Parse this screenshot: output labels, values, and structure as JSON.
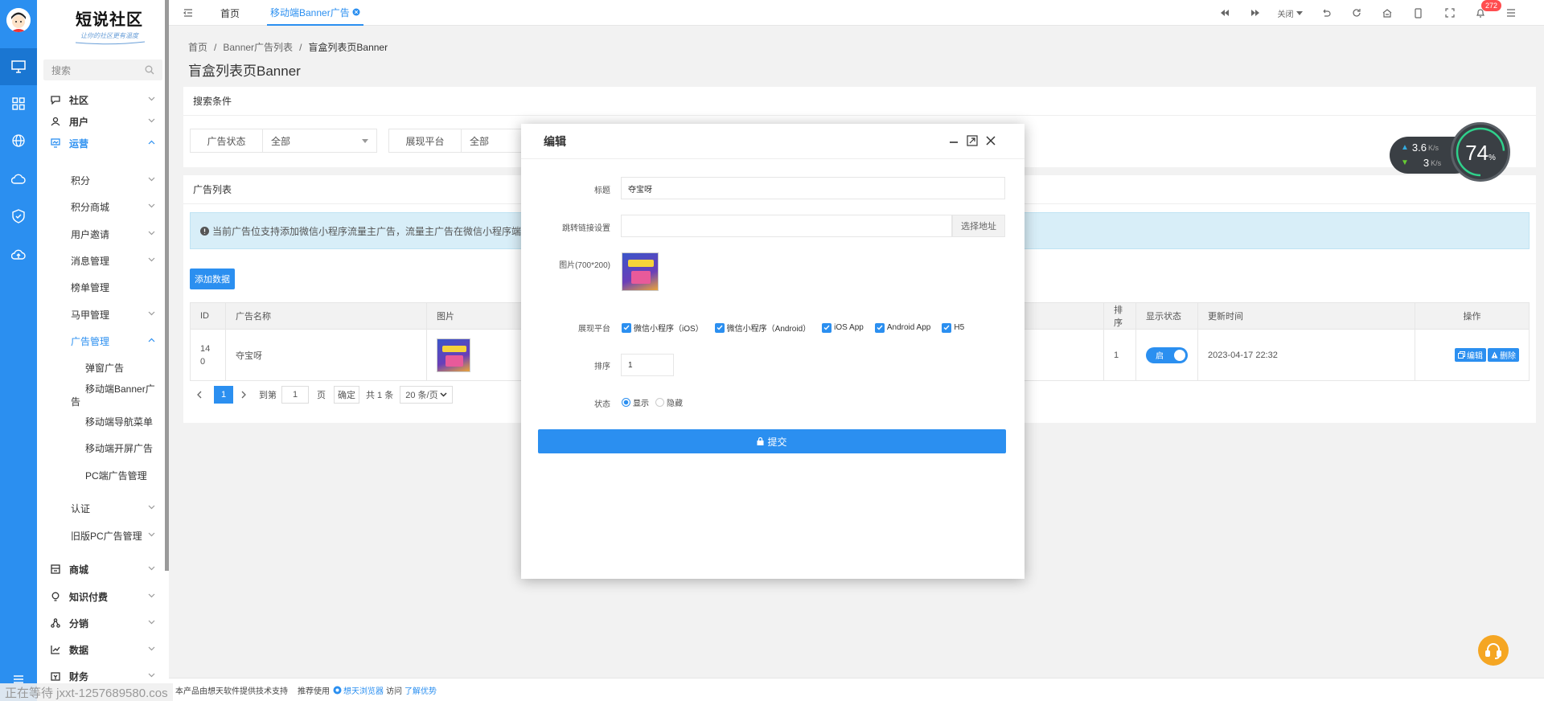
{
  "app": {
    "logo_text": "短说社区",
    "logo_sub": "让你的社区更有温度"
  },
  "colors": {
    "primary": "#2b8ff0",
    "rail": "#2b8ff0",
    "badge": "#ff4d4f",
    "notice_bg": "#d8eef8"
  },
  "rail": {
    "icons": [
      "desktop-icon",
      "grid-icon",
      "globe-icon",
      "cloud-icon",
      "shield-check-icon",
      "cloud-upload-icon"
    ],
    "bottom_icon": "menu-icon"
  },
  "menu": {
    "search_placeholder": "搜索",
    "items": [
      {
        "label": "社区",
        "icon": "chat-icon"
      },
      {
        "label": "用户",
        "icon": "user-icon"
      },
      {
        "label": "运营",
        "icon": "operate-icon"
      },
      {
        "label": "积分"
      },
      {
        "label": "积分商城"
      },
      {
        "label": "用户邀请"
      },
      {
        "label": "消息管理"
      },
      {
        "label": "榜单管理"
      },
      {
        "label": "马甲管理"
      },
      {
        "label": "广告管理"
      },
      {
        "label": "弹窗广告"
      },
      {
        "label": "移动端Banner广告"
      },
      {
        "label": "移动端导航菜单"
      },
      {
        "label": "移动端开屏广告"
      },
      {
        "label": "PC端广告管理"
      },
      {
        "label": "认证"
      },
      {
        "label": "旧版PC广告管理"
      },
      {
        "label": "商城",
        "icon": "shop-icon"
      },
      {
        "label": "知识付费",
        "icon": "bulb-icon"
      },
      {
        "label": "分销",
        "icon": "share-icon"
      },
      {
        "label": "数据",
        "icon": "chart-icon"
      },
      {
        "label": "财务",
        "icon": "wallet-icon"
      }
    ]
  },
  "tabs": {
    "home": "首页",
    "active": "移动端Banner广告"
  },
  "toolbar": {
    "close_label": "关闭",
    "badge_count": "272"
  },
  "breadcrumb": {
    "b1": "首页",
    "b2": "Banner广告列表",
    "b3": "盲盒列表页Banner",
    "sep": "/"
  },
  "page_title": "盲盒列表页Banner",
  "search": {
    "title": "搜索条件",
    "status_label": "广告状态",
    "status_value": "全部",
    "platform_label": "展现平台",
    "platform_value": "全部"
  },
  "list": {
    "title": "广告列表",
    "notice": "当前广告位支持添加微信小程序流量主广告，流量主广告在微信小程序端将",
    "add_button": "添加数据",
    "columns": {
      "id": "ID",
      "name": "广告名称",
      "image": "图片",
      "sort": "排序",
      "status": "显示状态",
      "updated": "更新时间",
      "ops": "操作"
    },
    "rows": [
      {
        "id_line1": "14",
        "id_line2": "0",
        "name": "夺宝呀",
        "sort": "1",
        "status_label": "启",
        "updated": "2023-04-17 22:32",
        "edit": "编辑",
        "delete": "删除"
      }
    ],
    "pager": {
      "current": "1",
      "goto_label": "到第",
      "page_value": "1",
      "page_unit": "页",
      "confirm": "确定",
      "total": "共 1 条",
      "per_page": "20 条/页"
    }
  },
  "modal": {
    "title": "编辑",
    "title_label": "标题",
    "title_value": "夺宝呀",
    "link_label": "跳转链接设置",
    "link_value": "",
    "select_address": "选择地址",
    "image_label": "图片(700*200)",
    "platform_label": "展现平台",
    "platforms": [
      "微信小程序（iOS）",
      "微信小程序（Android）",
      "iOS App",
      "Android App",
      "H5"
    ],
    "sort_label": "排序",
    "sort_value": "1",
    "state_label": "状态",
    "state_show": "显示",
    "state_hide": "隐藏",
    "submit": "提交"
  },
  "speed": {
    "up": "3.6",
    "down": "3",
    "unit": "K/s",
    "percent": "74",
    "percent_sign": "%"
  },
  "footer": {
    "text1": "本产品由想天软件提供技术支持",
    "text2": "推荐使用",
    "browser": "想天浏览器",
    "text3": "访问",
    "link": "了解优势"
  },
  "status_bar": "正在等待 jxxt-1257689580.cos"
}
